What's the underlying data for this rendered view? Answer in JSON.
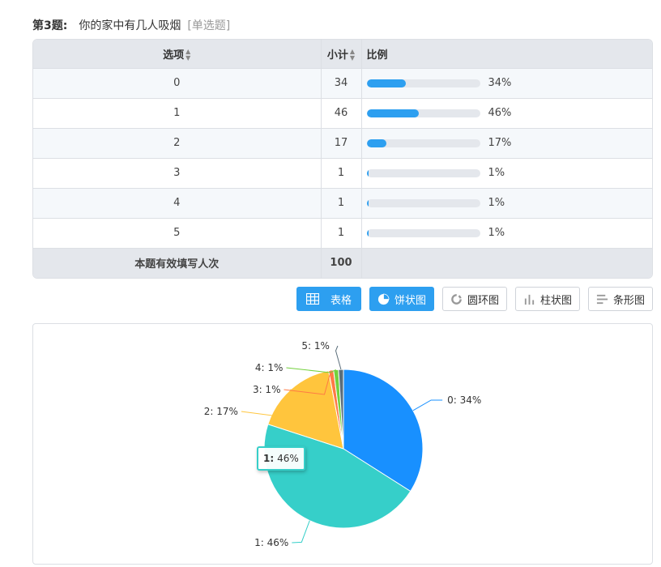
{
  "question": {
    "number": "第3题:",
    "title": "你的家中有几人吸烟",
    "type": "[单选题]"
  },
  "table": {
    "headers": {
      "option": "选项",
      "count": "小计",
      "ratio": "比例"
    },
    "sort_glyph": "▲▼",
    "rows": [
      {
        "option": "0",
        "count": "34",
        "percent": "34%",
        "fraction": 0.34
      },
      {
        "option": "1",
        "count": "46",
        "percent": "46%",
        "fraction": 0.46
      },
      {
        "option": "2",
        "count": "17",
        "percent": "17%",
        "fraction": 0.17
      },
      {
        "option": "3",
        "count": "1",
        "percent": "1%",
        "fraction": 0.01
      },
      {
        "option": "4",
        "count": "1",
        "percent": "1%",
        "fraction": 0.01
      },
      {
        "option": "5",
        "count": "1",
        "percent": "1%",
        "fraction": 0.01
      }
    ],
    "total": {
      "label": "本题有效填写人次",
      "value": "100"
    }
  },
  "view_buttons": [
    {
      "label": "表格",
      "icon": "table-icon",
      "active": true
    },
    {
      "label": "饼状图",
      "icon": "pie-icon",
      "active": true
    },
    {
      "label": "圆环图",
      "icon": "donut-icon",
      "active": false
    },
    {
      "label": "柱状图",
      "icon": "bar-chart-icon",
      "active": false
    },
    {
      "label": "条形图",
      "icon": "hbar-chart-icon",
      "active": false
    }
  ],
  "chart_data": {
    "type": "pie",
    "categories": [
      "0",
      "1",
      "2",
      "3",
      "4",
      "5"
    ],
    "values": [
      34,
      46,
      17,
      1,
      1,
      1
    ],
    "labels": [
      "0: 34%",
      "1: 46%",
      "2: 17%",
      "3: 1%",
      "4: 1%",
      "5: 1%"
    ],
    "colors": [
      "#1890ff",
      "#36cfc9",
      "#ffc53d",
      "#ff7a45",
      "#73d13d",
      "#5b6e7a"
    ],
    "tooltip": {
      "key": "1:",
      "value": "46%"
    }
  },
  "colors": {
    "accent": "#2d9ff0",
    "bar_track": "#e4e7ec",
    "header_bg": "#e4e7ec"
  }
}
